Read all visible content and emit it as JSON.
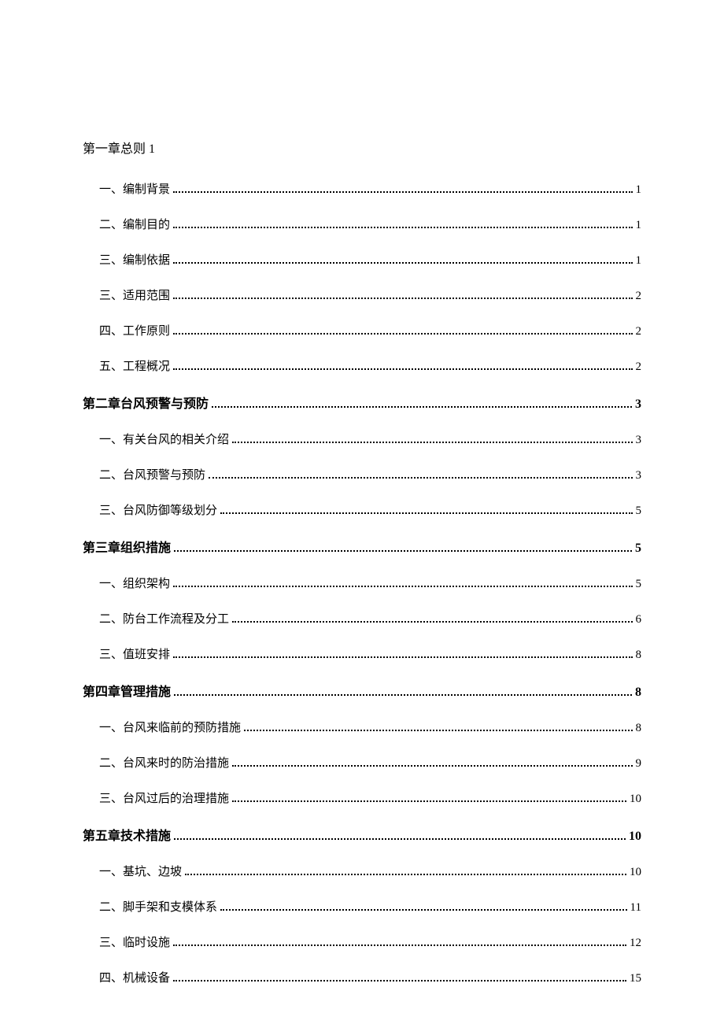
{
  "toc": {
    "chapter1": {
      "heading": "第一章总则 1",
      "items": [
        {
          "label": "一、编制背景",
          "page": "1"
        },
        {
          "label": "二、编制目的",
          "page": "1"
        },
        {
          "label": "三、编制依据",
          "page": "1"
        },
        {
          "label": "三、适用范围",
          "page": "2"
        },
        {
          "label": "四、工作原则",
          "page": "2"
        },
        {
          "label": "五、工程概况",
          "page": "2"
        }
      ]
    },
    "chapter2": {
      "heading": "第二章台风预警与预防",
      "page": "3",
      "items": [
        {
          "label": "一、有关台风的相关介绍",
          "page": "3"
        },
        {
          "label": "二、台风预警与预防",
          "page": "3"
        },
        {
          "label": "三、台风防御等级划分",
          "page": "5"
        }
      ]
    },
    "chapter3": {
      "heading": "第三章组织措施",
      "page": "5",
      "items": [
        {
          "label": "一、组织架构",
          "page": "5"
        },
        {
          "label": "二、防台工作流程及分工",
          "page": "6"
        },
        {
          "label": "三、值班安排",
          "page": "8"
        }
      ]
    },
    "chapter4": {
      "heading": "第四章管理措施",
      "page": "8",
      "items": [
        {
          "label": "一、台风来临前的预防措施",
          "page": "8"
        },
        {
          "label": "二、台风来时的防治措施",
          "page": "9"
        },
        {
          "label": "三、台风过后的治理措施",
          "page": "10"
        }
      ]
    },
    "chapter5": {
      "heading": "第五章技术措施",
      "page": "10",
      "items": [
        {
          "label": "一、基坑、边坡",
          "page": "10"
        },
        {
          "label": "二、脚手架和支模体系",
          "page": "11"
        },
        {
          "label": "三、临时设施",
          "page": "12"
        },
        {
          "label": "四、机械设备",
          "page": "15"
        }
      ]
    }
  }
}
